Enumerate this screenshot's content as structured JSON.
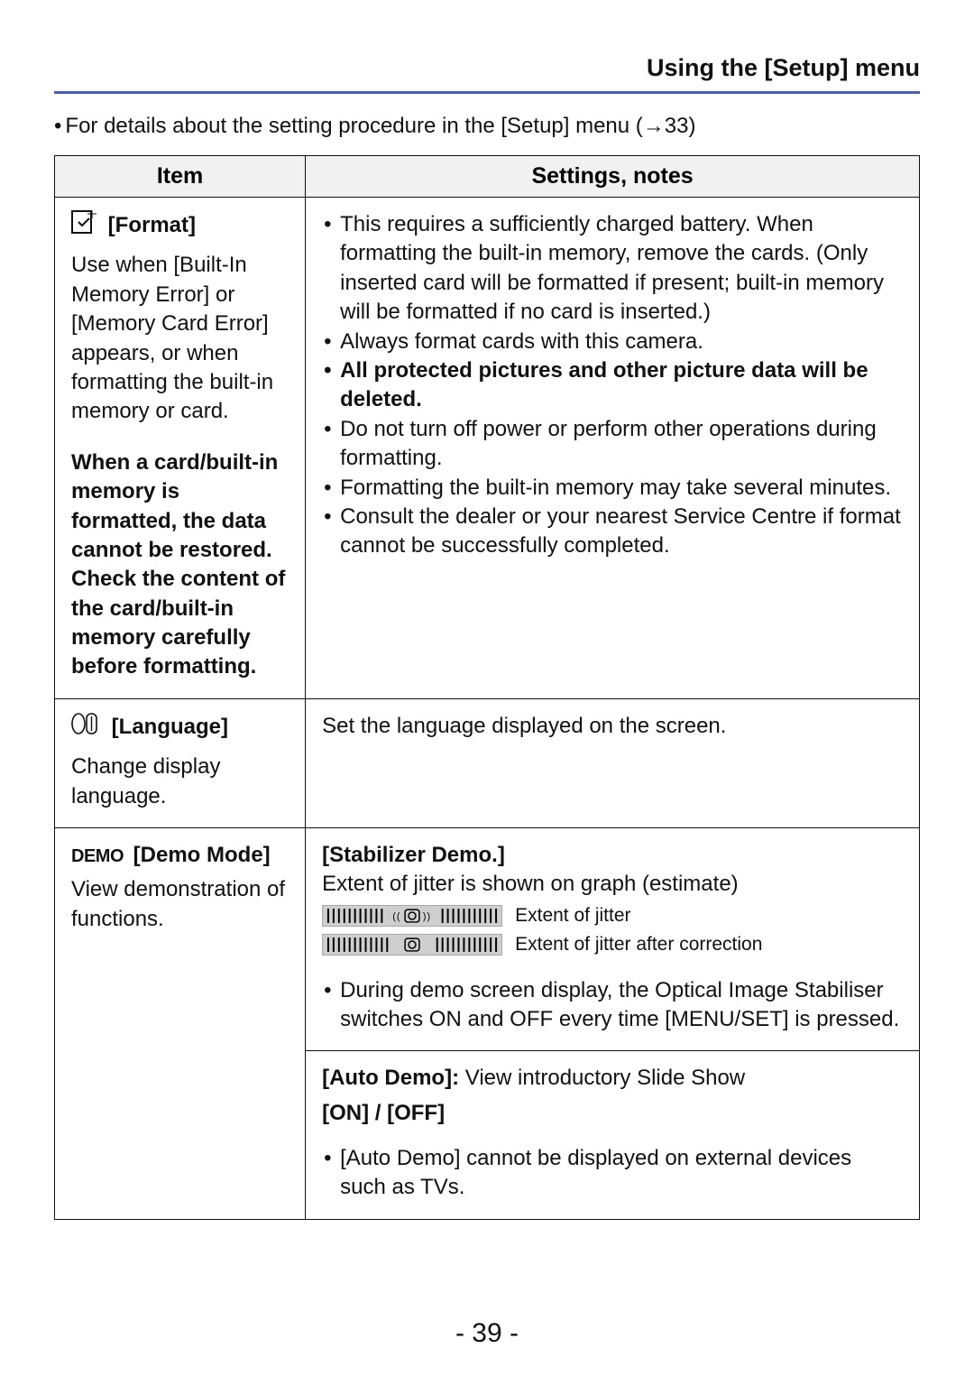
{
  "header": {
    "title": "Using the [Setup] menu"
  },
  "intro": "For details about the setting procedure in the [Setup] menu (→33)",
  "columns": {
    "item": "Item",
    "notes": "Settings, notes"
  },
  "rows": {
    "format": {
      "title": "[Format]",
      "desc1": "Use when [Built-In Memory Error] or [Memory Card Error] appears, or when formatting the built-in memory or card.",
      "desc2": "When a card/built-in memory is formatted, the data cannot be restored. Check the content of the card/built-in memory carefully before formatting.",
      "note1": "This requires a sufficiently charged battery. When formatting the built-in memory, remove the cards. (Only inserted card will be formatted if present; built-in memory will be formatted if no card is inserted.)",
      "note2": "Always format cards with this camera.",
      "note3": "All protected pictures and other picture data will be deleted.",
      "note4": "Do not turn off power or perform other operations during formatting.",
      "note5": "Formatting the built-in memory may take several minutes.",
      "note6": "Consult the dealer or your nearest Service Centre if format cannot be successfully completed."
    },
    "language": {
      "title": "[Language]",
      "desc": "Change display language.",
      "note": "Set the language displayed on the screen."
    },
    "demo": {
      "prefix": "DEMO",
      "title": "[Demo Mode]",
      "desc": "View demonstration of functions.",
      "stab_title": "[Stabilizer Demo.]",
      "stab_desc": "Extent of jitter is shown on graph (estimate)",
      "jitter1": "Extent of jitter",
      "jitter2": "Extent of jitter after correction",
      "stab_note": "During demo screen display, the Optical Image Stabiliser switches ON and OFF every time [MENU/SET] is pressed.",
      "auto_title": "[Auto Demo]:",
      "auto_desc": "View introductory Slide Show",
      "auto_options": "[ON] / [OFF]",
      "auto_note": "[Auto Demo] cannot be displayed on external devices such as TVs."
    }
  },
  "pageNumber": "- 39 -"
}
